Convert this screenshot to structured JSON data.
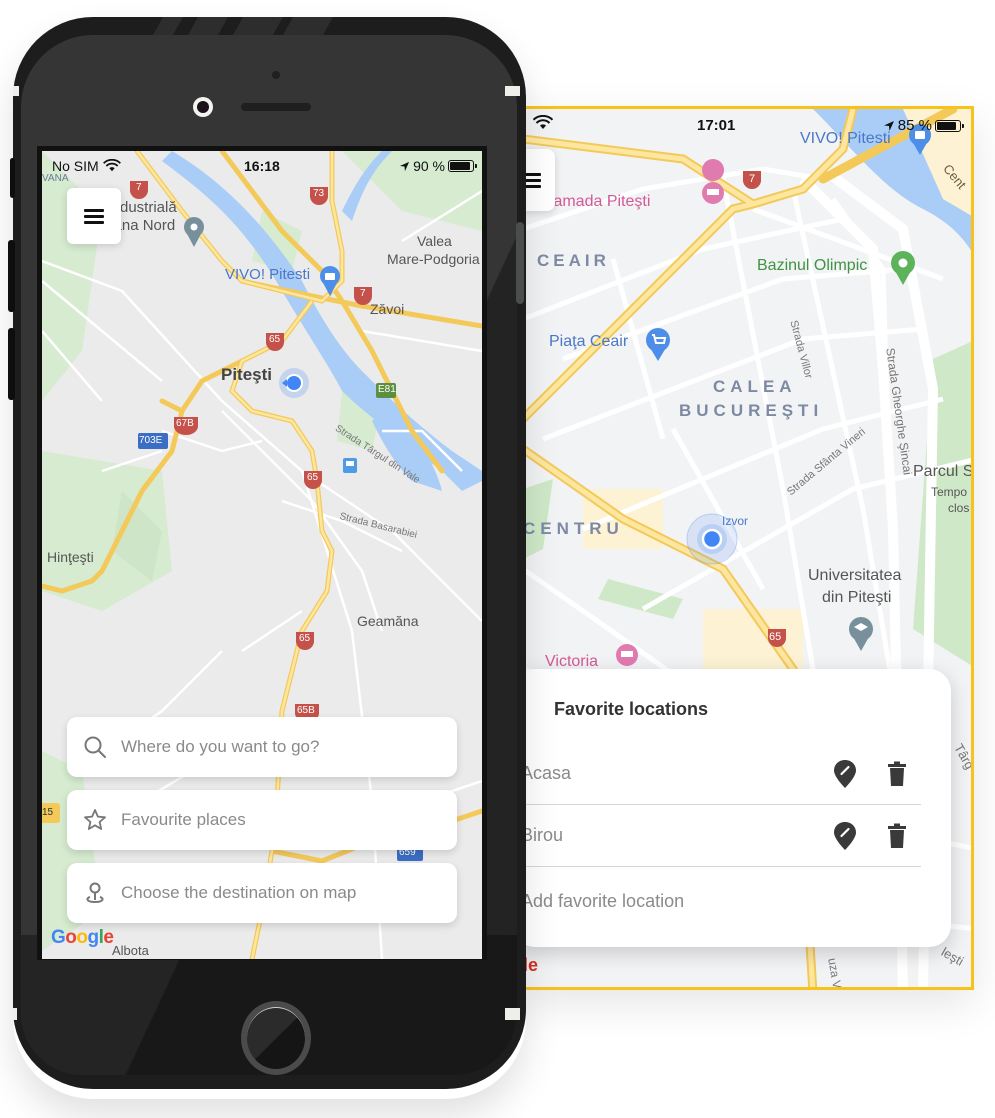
{
  "back_screen": {
    "status": {
      "time": "17:01",
      "battery": "85 %",
      "battery_level": 0.85
    },
    "map_labels": {
      "hotel": "el Ramada Piteşti",
      "vivo": "VIVO! Pitesti",
      "centru_road": "Cent",
      "ceair": "CEAIR",
      "bazinul": "Bazinul Olimpic",
      "piata": "Piaţa Ceair",
      "calea1": "CALEA",
      "calea2": "BUCUREŞTI",
      "strada_villor": "Strada Villor",
      "strada_sincai": "Strada Gheorghe Şincai",
      "strada_vineri": "Strada Sfânta Vineri",
      "parcul": "Parcul S",
      "tempo": "Tempo",
      "clos": "clos",
      "centru": "CENTRU",
      "izvor": "Izvor",
      "universitatea1": "Universitatea",
      "universitatea2": "din Piteşti",
      "victoria": "Victoria",
      "route_7": "7",
      "route_65": "65",
      "targ": "Târg",
      "lesti": "leşti",
      "cuza": "uza Vod",
      "google_tail": "le"
    },
    "favorites_panel": {
      "title": "Favorite locations",
      "items": [
        {
          "name": "Acasa"
        },
        {
          "name": "Birou"
        }
      ],
      "add_label": "Add favorite location"
    }
  },
  "main_phone": {
    "status": {
      "carrier": "No SIM",
      "time": "16:18",
      "battery": "90 %",
      "battery_level": 0.9
    },
    "map_labels": {
      "vana": "VANA",
      "industriala1": "dustrială",
      "industriala2": "Gavana Nord",
      "vivo": "VIVO! Pitesti",
      "valea1": "Valea",
      "valea2": "Mare-Podgoria",
      "zavoi": "Zăvoi",
      "pitesti": "Piteşti",
      "strada_targului": "Strada Târgul din Vale",
      "strada_basarabiei": "Strada Basarabiei",
      "hintesti": "Hinţeşti",
      "geamana": "Geamăna",
      "albota": "Albota",
      "r7a": "7",
      "r73": "73",
      "r7b": "7",
      "r65a": "65",
      "r67b": "67B",
      "r703e": "703E",
      "re81": "E81",
      "r65b": "65",
      "r65c": "65",
      "r65d": "65B",
      "r15": "15",
      "r659": "659"
    },
    "actions": [
      {
        "label": "Where do you want to go?",
        "icon": "search-icon"
      },
      {
        "label": "Favourite places",
        "icon": "star-icon"
      },
      {
        "label": "Choose the destination on map",
        "icon": "map-pin-icon"
      }
    ],
    "google_logo": [
      "G",
      "o",
      "o",
      "g",
      "l",
      "e"
    ]
  },
  "colors": {
    "accent_border": "#f7c21a",
    "location_dot": "#4285f4",
    "road": "#f8d36a",
    "water": "#a9cdf7",
    "park": "#cfe9c8",
    "route_shield": "#c5524a"
  }
}
